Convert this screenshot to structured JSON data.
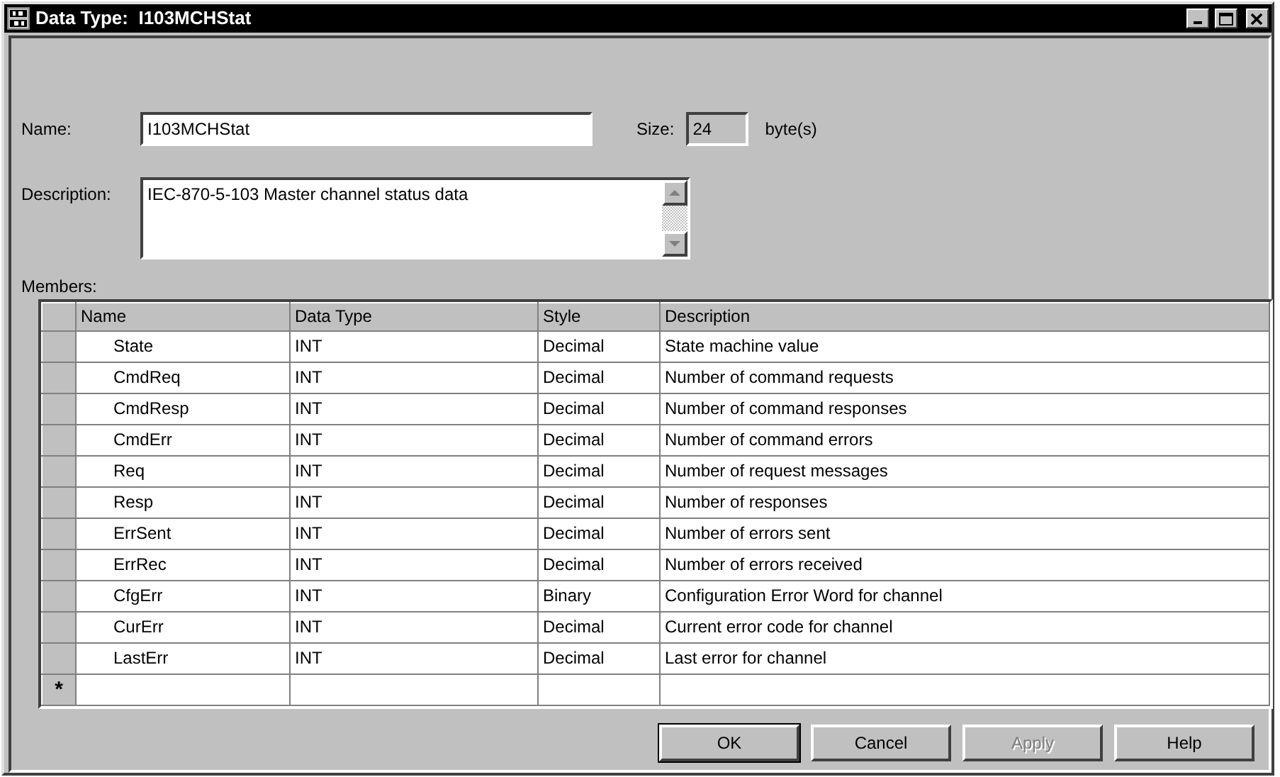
{
  "window": {
    "title": "Data Type:  I103MCHStat"
  },
  "name": {
    "label": "Name:",
    "value": "I103MCHStat"
  },
  "size": {
    "label": "Size:",
    "value": "24",
    "unit": "byte(s)"
  },
  "description": {
    "label": "Description:",
    "value": "IEC-870-5-103 Master channel status data"
  },
  "members": {
    "label": "Members:",
    "columns": [
      "Name",
      "Data Type",
      "Style",
      "Description"
    ],
    "rows": [
      {
        "kind": "member",
        "cells": [
          "State",
          "INT",
          "Decimal",
          "State machine value"
        ]
      },
      {
        "kind": "member",
        "cells": [
          "CmdReq",
          "INT",
          "Decimal",
          "Number of command requests"
        ]
      },
      {
        "kind": "member",
        "cells": [
          "CmdResp",
          "INT",
          "Decimal",
          "Number of command responses"
        ]
      },
      {
        "kind": "member",
        "cells": [
          "CmdErr",
          "INT",
          "Decimal",
          "Number of command errors"
        ]
      },
      {
        "kind": "member",
        "cells": [
          "Req",
          "INT",
          "Decimal",
          "Number of request messages"
        ]
      },
      {
        "kind": "member",
        "cells": [
          "Resp",
          "INT",
          "Decimal",
          "Number of responses"
        ]
      },
      {
        "kind": "member",
        "cells": [
          "ErrSent",
          "INT",
          "Decimal",
          "Number of errors sent"
        ]
      },
      {
        "kind": "member",
        "cells": [
          "ErrRec",
          "INT",
          "Decimal",
          "Number of errors received"
        ]
      },
      {
        "kind": "member",
        "cells": [
          "CfgErr",
          "INT",
          "Binary",
          "Configuration Error Word for channel"
        ]
      },
      {
        "kind": "member",
        "cells": [
          "CurErr",
          "INT",
          "Decimal",
          "Current error code for channel"
        ]
      },
      {
        "kind": "member",
        "cells": [
          "LastErr",
          "INT",
          "Decimal",
          "Last error for channel"
        ]
      },
      {
        "kind": "new",
        "marker": "*"
      }
    ]
  },
  "buttons": [
    {
      "label": "OK",
      "default": true,
      "disabled": false
    },
    {
      "label": "Cancel",
      "default": false,
      "disabled": false
    },
    {
      "label": "Apply",
      "default": false,
      "disabled": true
    },
    {
      "label": "Help",
      "default": false,
      "disabled": false
    }
  ]
}
